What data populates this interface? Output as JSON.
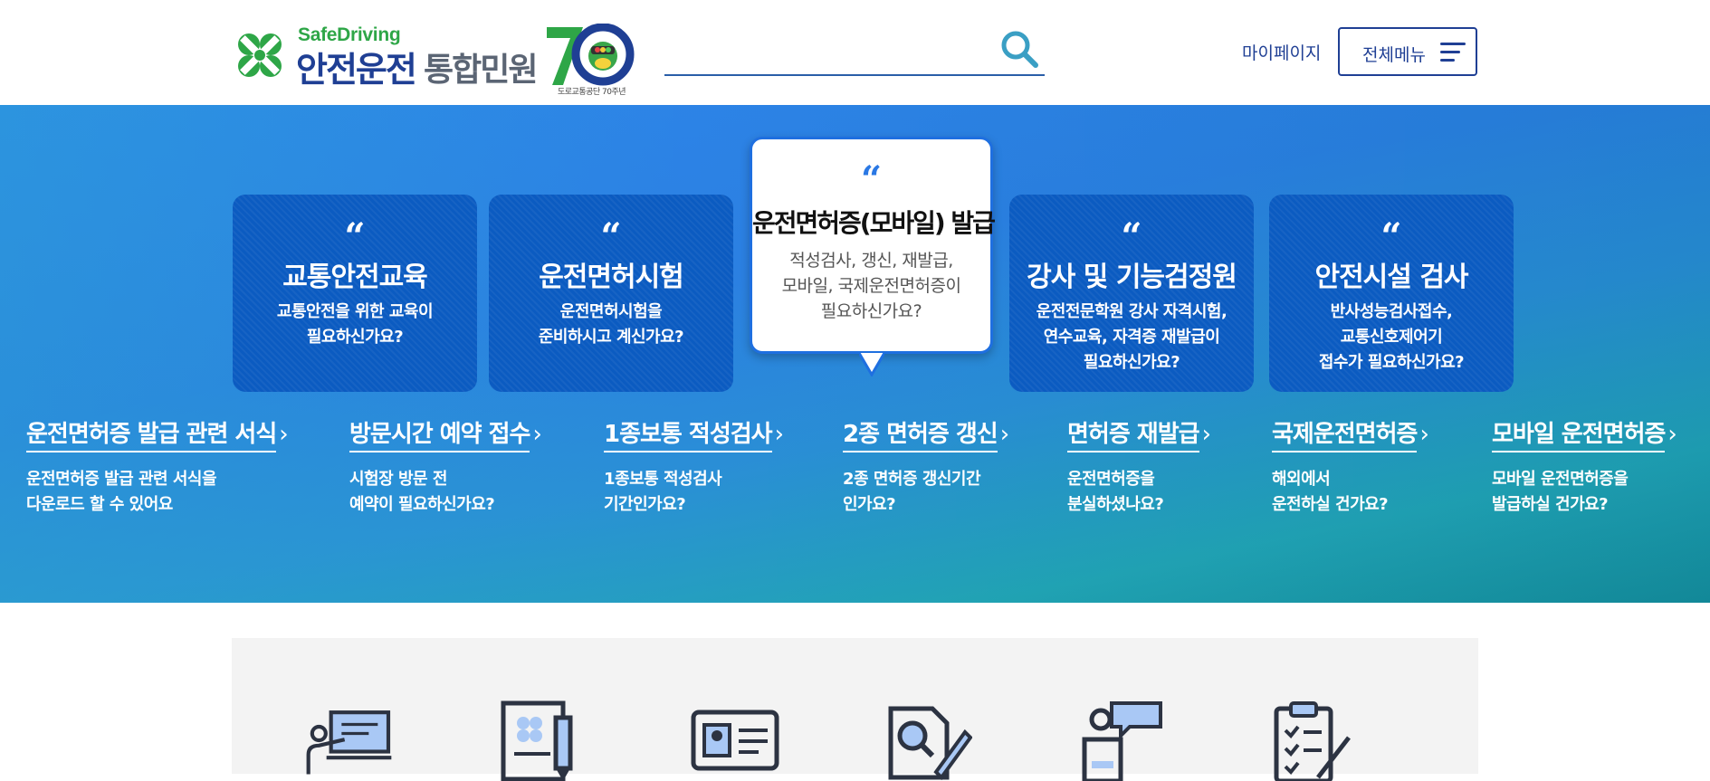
{
  "header": {
    "logo_en": "SafeDriving",
    "logo_ko_main": "안전운전",
    "logo_ko_sub": "통합민원",
    "logo_70_caption": "도로교통공단 70주년",
    "search": {
      "placeholder": "",
      "value": ""
    },
    "mypage_label": "마이페이지",
    "allmenu_label": "전체메뉴"
  },
  "cards": [
    {
      "title": "교통안전교육",
      "desc": "교통안전을 위한 교육이\n필요하신가요?",
      "active": false
    },
    {
      "title": "운전면허시험",
      "desc": "운전면허시험을\n준비하시고 계신가요?",
      "active": false
    },
    {
      "title": "운전면허증(모바일) 발급",
      "desc": "적성검사, 갱신, 재발급,\n모바일, 국제운전면허증이\n필요하신가요?",
      "active": true
    },
    {
      "title": "강사 및 기능검정원",
      "desc": "운전전문학원 강사 자격시험,\n연수교육, 자격증 재발급이\n필요하신가요?",
      "active": false
    },
    {
      "title": "안전시설 검사",
      "desc": "반사성능검사접수,\n교통신호제어기\n접수가 필요하신가요?",
      "active": false
    }
  ],
  "quote_mark": "“",
  "links": [
    {
      "title": "운전면허증 발급 관련 서식",
      "desc": "운전면허증 발급 관련 서식을\n다운로드 할 수 있어요"
    },
    {
      "title": "방문시간 예약 접수",
      "desc": "시험장 방문 전\n예약이 필요하신가요?"
    },
    {
      "title": "1종보통 적성검사",
      "desc": "1종보통 적성검사\n기간인가요?"
    },
    {
      "title": "2종 면허증 갱신",
      "desc": "2종 면허증 갱신기간\n인가요?"
    },
    {
      "title": "면허증 재발급",
      "desc": "운전면허증을\n분실하셨나요?"
    },
    {
      "title": "국제운전면허증",
      "desc": "해외에서\n운전하실 건가요?"
    },
    {
      "title": "모바일 운전면허증",
      "desc": "모바일 운전면허증을\n발급하실 건가요?"
    }
  ],
  "link_arrow": "›",
  "quick_icons": [
    "presentation-icon",
    "document-pen-icon",
    "id-card-icon",
    "inspection-icon",
    "speaker-podium-icon",
    "checklist-icon"
  ],
  "colors": {
    "brand_blue": "#1f3f94",
    "brand_green": "#2ea647",
    "hero_blue": "#2e86ea",
    "hero_teal": "#15909a",
    "card_blue": "#0b5bc1",
    "icon_blue": "#a9c8f5",
    "icon_stroke": "#2c3342"
  }
}
